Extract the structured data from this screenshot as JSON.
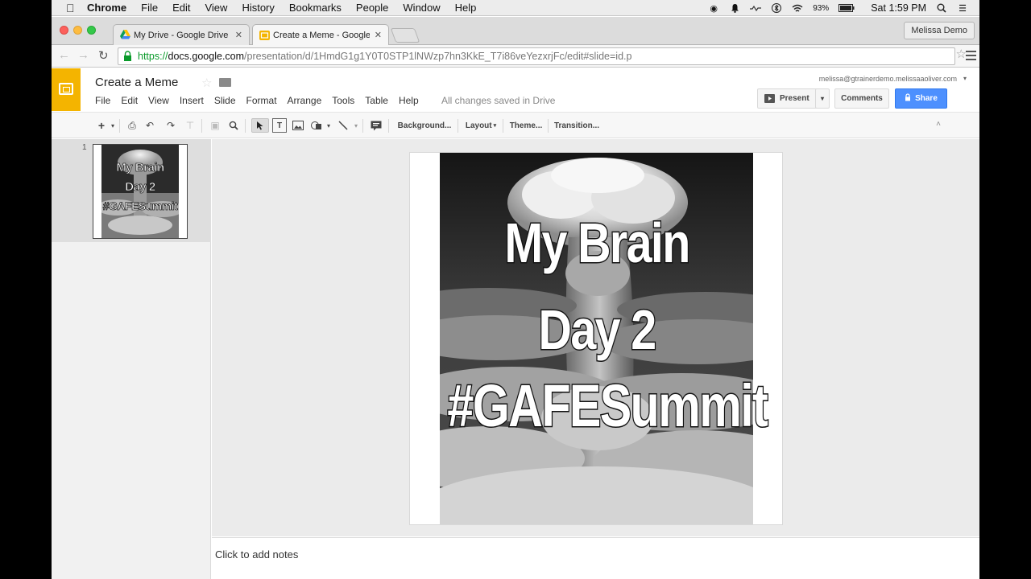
{
  "mac_menubar": {
    "apple_icon": "apple-icon",
    "items": [
      "Chrome",
      "File",
      "Edit",
      "View",
      "History",
      "Bookmarks",
      "People",
      "Window",
      "Help"
    ],
    "battery": "93%",
    "clock": "Sat 1:59 PM",
    "status_icons": [
      "record-icon",
      "notification-bell-icon",
      "activity-icon",
      "bluetooth-icon",
      "wifi-icon",
      "battery-icon",
      "spotlight-search-icon",
      "list-icon"
    ]
  },
  "browser": {
    "tabs": [
      {
        "title": "My Drive - Google Drive",
        "icon": "google-drive-icon",
        "active": false
      },
      {
        "title": "Create a Meme - Google S",
        "icon": "google-slides-icon",
        "active": true
      }
    ],
    "profile": "Melissa Demo",
    "url": {
      "scheme": "https://",
      "host": "docs.google.com",
      "path": "/presentation/d/1HmdG1g1Y0T0STP1lNWzp7hn3KkE_T7i86veYezxrjFc/edit#slide=id.p"
    }
  },
  "doc": {
    "title": "Create a Meme",
    "menus": [
      "File",
      "Edit",
      "View",
      "Insert",
      "Slide",
      "Format",
      "Arrange",
      "Tools",
      "Table",
      "Help"
    ],
    "save_status": "All changes saved in Drive",
    "account": "melissa@gtrainerdemo.melissaaoliver.com",
    "buttons": {
      "present": "Present",
      "comments": "Comments",
      "share": "Share"
    }
  },
  "toolbar": {
    "background": "Background...",
    "layout": "Layout",
    "theme": "Theme...",
    "transition": "Transition..."
  },
  "filmstrip": {
    "slides": [
      {
        "number": "1",
        "lines": [
          "My Brain",
          "Day 2",
          "#GAFESummit"
        ]
      }
    ]
  },
  "slide": {
    "lines": [
      "My Brain",
      "Day 2",
      "#GAFESummit"
    ]
  },
  "notes": {
    "placeholder": "Click to add notes"
  }
}
